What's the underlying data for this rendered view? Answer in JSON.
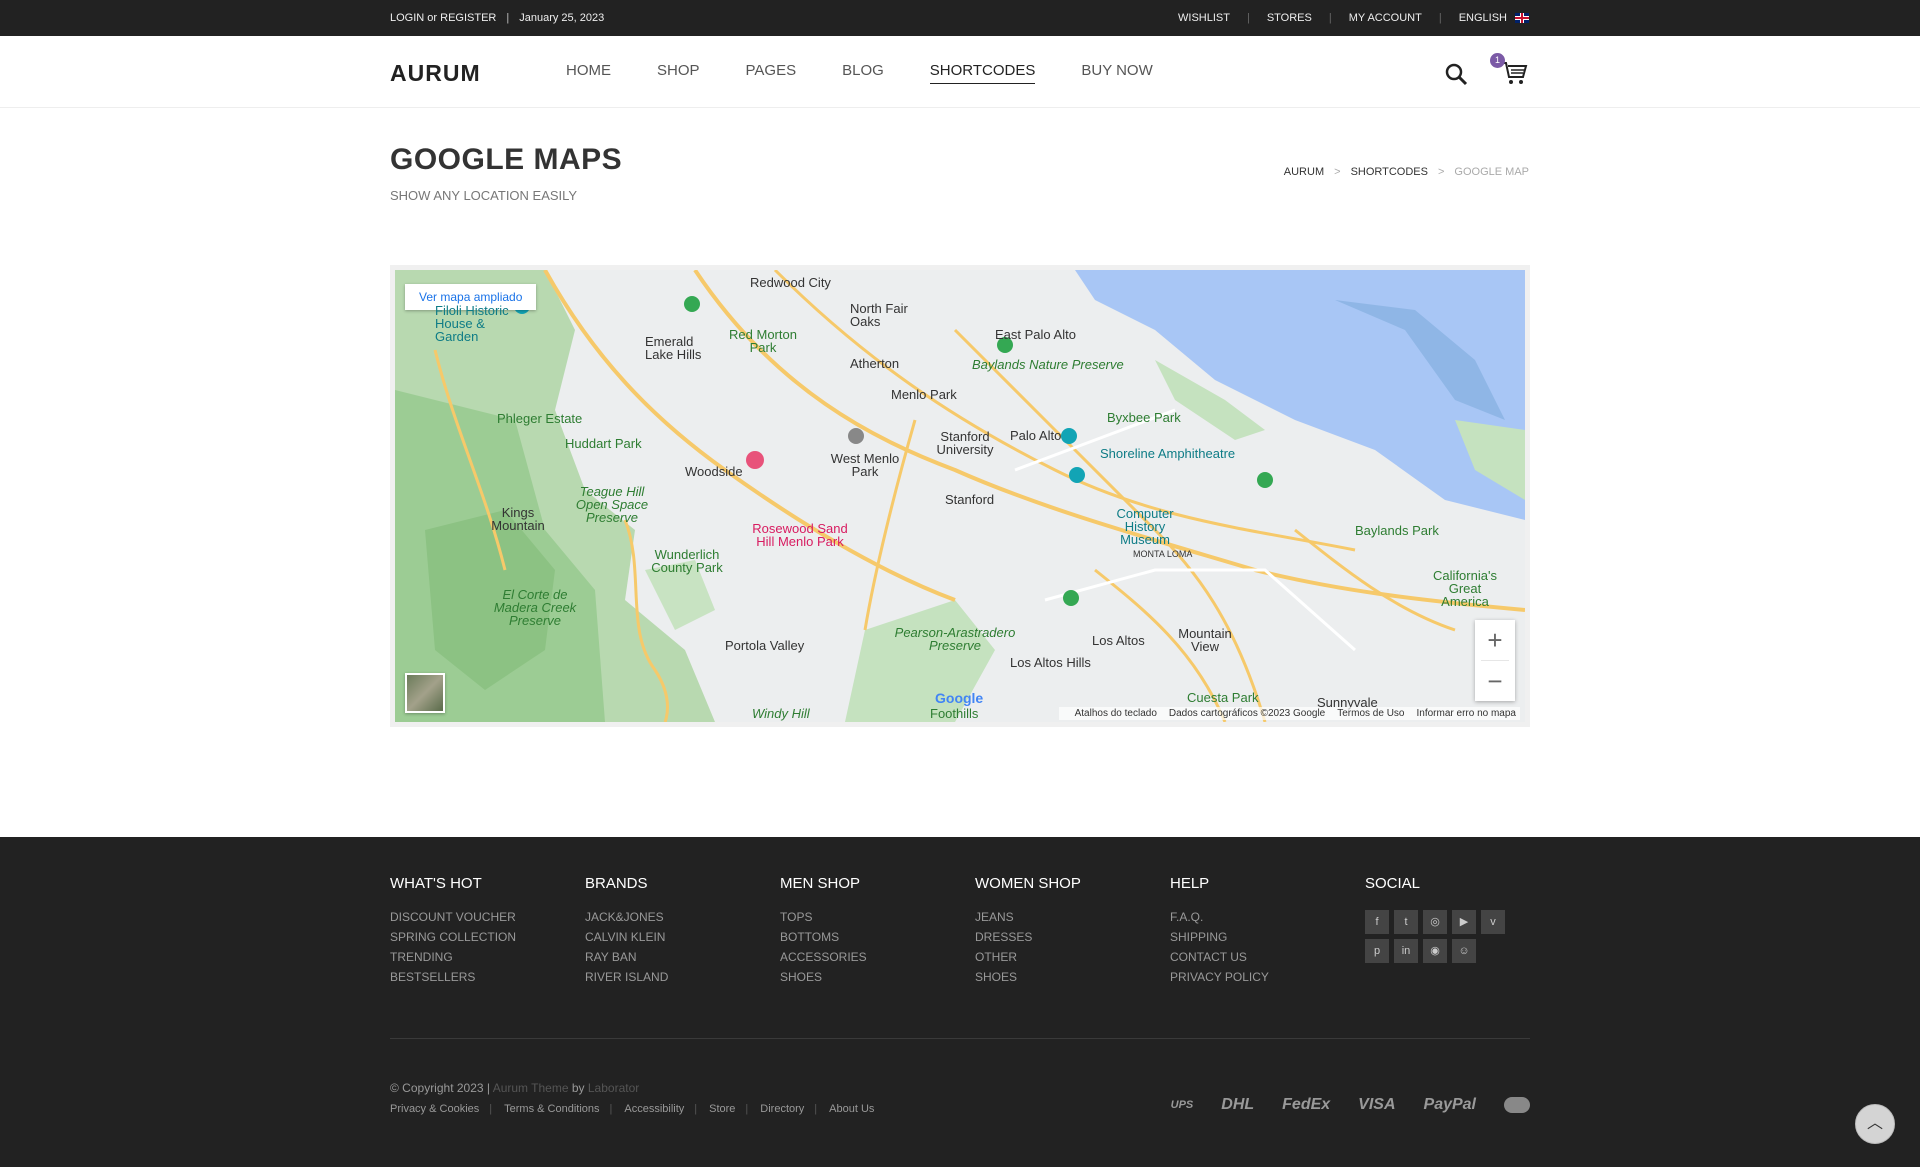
{
  "topbar": {
    "login": "LOGIN or REGISTER",
    "date": "January 25, 2023",
    "links": [
      "WISHLIST",
      "STORES",
      "MY ACCOUNT",
      "ENGLISH"
    ]
  },
  "header": {
    "logo": "AURUM",
    "nav": [
      "HOME",
      "SHOP",
      "PAGES",
      "BLOG",
      "SHORTCODES",
      "BUY NOW"
    ],
    "cart_count": "1"
  },
  "page": {
    "title": "GOOGLE MAPS",
    "subtitle": "SHOW ANY LOCATION EASILY",
    "breadcrumb": [
      "AURUM",
      "SHORTCODES",
      "GOOGLE MAP"
    ]
  },
  "map": {
    "link": "Ver mapa ampliado",
    "labels": {
      "redwood_city": "Redwood City",
      "north_fair_oaks": "North Fair Oaks",
      "east_palo_alto": "East Palo Alto",
      "emerald_lake_hills": "Emerald Lake Hills",
      "red_morton_park": "Red Morton Park",
      "atherton": "Atherton",
      "baylands_nature": "Baylands Nature Preserve",
      "menlo_park": "Menlo Park",
      "filoli": "Filoli Historic House & Garden",
      "phleger": "Phleger Estate",
      "huddart": "Huddart Park",
      "byxbee": "Byxbee Park",
      "stanford_uni": "Stanford University",
      "palo_alto": "Palo Alto",
      "shoreline": "Shoreline Amphitheatre",
      "west_menlo_park": "West Menlo Park",
      "woodside": "Woodside",
      "stanford": "Stanford",
      "teague": "Teague Hill Open Space Preserve",
      "kings_mountain": "Kings Mountain",
      "rosewood": "Rosewood Sand Hill Menlo Park",
      "computer_museum": "Computer History Museum",
      "baylands_park": "Baylands Park",
      "wunderlich": "Wunderlich County Park",
      "monta_loma": "MONTA LOMA",
      "great_america": "California's Great America",
      "el_corte": "El Corte de Madera Creek Preserve",
      "pearson": "Pearson-Arastradero Preserve",
      "portola_valley": "Portola Valley",
      "los_altos": "Los Altos",
      "mountain_view": "Mountain View",
      "los_altos_hills": "Los Altos Hills",
      "cuesta": "Cuesta Park",
      "sunnyvale": "Sunnyvale",
      "windy_hill": "Windy Hill",
      "foothills": "Foothills"
    },
    "footer": [
      "Atalhos do teclado",
      "Dados cartográficos ©2023 Google",
      "Termos de Uso",
      "Informar erro no mapa"
    ],
    "google": "Google"
  },
  "footer": {
    "columns": [
      {
        "title": "WHAT'S HOT",
        "items": [
          "DISCOUNT VOUCHER",
          "SPRING COLLECTION",
          "TRENDING",
          "BESTSELLERS"
        ]
      },
      {
        "title": "BRANDS",
        "items": [
          "JACK&JONES",
          "CALVIN KLEIN",
          "RAY BAN",
          "RIVER ISLAND"
        ]
      },
      {
        "title": "MEN SHOP",
        "items": [
          "TOPS",
          "BOTTOMS",
          "ACCESSORIES",
          "SHOES"
        ]
      },
      {
        "title": "WOMEN SHOP",
        "items": [
          "JEANS",
          "DRESSES",
          "OTHER",
          "SHOES"
        ]
      },
      {
        "title": "HELP",
        "items": [
          "F.A.Q.",
          "SHIPPING",
          "CONTACT US",
          "PRIVACY POLICY"
        ]
      }
    ],
    "social_title": "SOCIAL",
    "social_icons": [
      "facebook-icon",
      "twitter-icon",
      "instagram-icon",
      "youtube-icon",
      "vimeo-icon",
      "pinterest-icon",
      "linkedin-icon",
      "dribbble-icon",
      "snapchat-icon"
    ],
    "copyright": "© Copyright 2023 |",
    "theme": "Aurum Theme",
    "by": "by",
    "author": "Laborator",
    "links": [
      "Privacy & Cookies",
      "Terms & Conditions",
      "Accessibility",
      "Store",
      "Directory",
      "About Us"
    ],
    "payments": [
      "UPS",
      "DHL",
      "FedEx",
      "VISA",
      "PayPal",
      "mastercard"
    ]
  }
}
